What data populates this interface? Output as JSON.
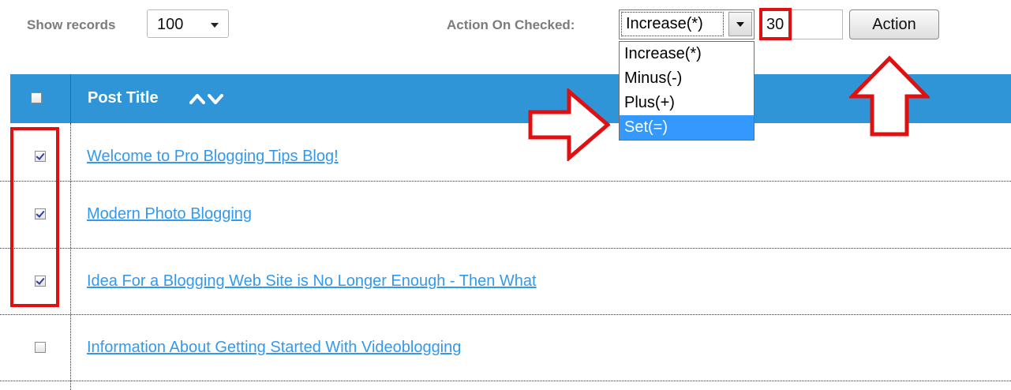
{
  "toolbar": {
    "show_records_label": "Show records",
    "show_records_value": "100",
    "action_on_checked_label": "Action On Checked:",
    "action_selected": "Increase(*)",
    "action_options": [
      "Increase(*)",
      "Minus(-)",
      "Plus(+)",
      "Set(=)"
    ],
    "highlighted_option": "Set(=)",
    "value": "30",
    "action_button_label": "Action"
  },
  "table": {
    "header_title": "Post Title",
    "rows": [
      {
        "title": "Welcome to Pro Blogging Tips Blog!",
        "checked": true
      },
      {
        "title": "Modern Photo Blogging",
        "checked": true
      },
      {
        "title": "Idea For a Blogging Web Site is No Longer Enough - Then What",
        "checked": true
      },
      {
        "title": "Information About Getting Started With Videoblogging",
        "checked": false
      }
    ]
  },
  "annotations": {
    "highlight_color": "#e01010"
  },
  "colors": {
    "header_bg": "#2f95d6",
    "link": "#3399ee",
    "selected_option_bg": "#3399ff"
  }
}
